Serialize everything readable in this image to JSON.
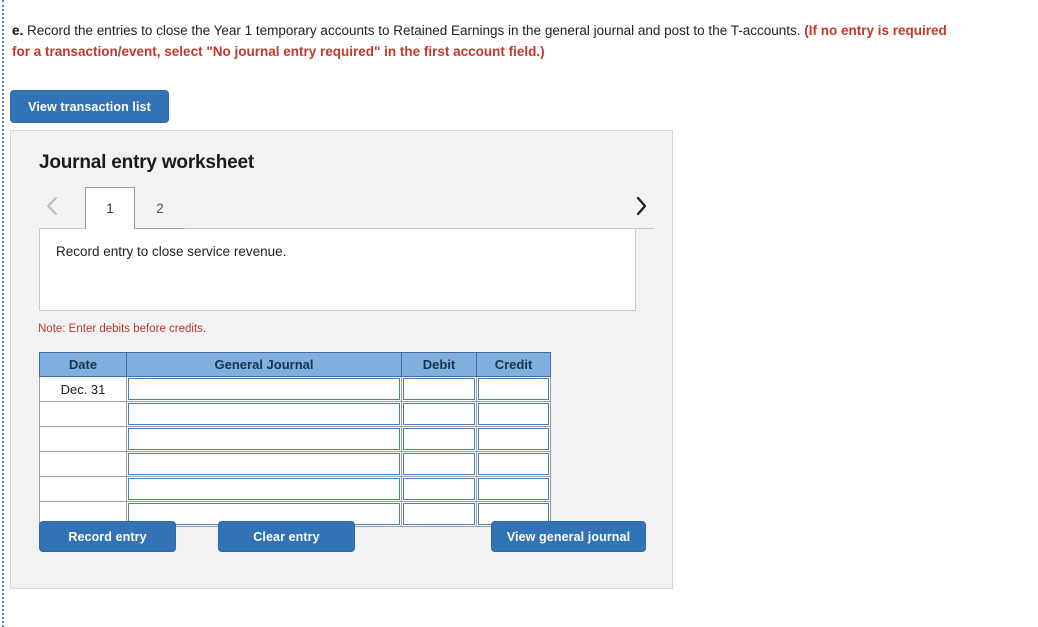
{
  "prompt": {
    "label": "e.",
    "text": " Record the entries to close the Year 1 temporary accounts to Retained Earnings in the general journal and post to the T-accounts. ",
    "requirement": "(If no entry is required for a transaction/event, select \"No journal entry required\" in the first account field.)"
  },
  "toolbar": {
    "view_transaction_list_label": "View transaction list"
  },
  "worksheet": {
    "title": "Journal entry worksheet",
    "prev_icon": "chevron-left-icon",
    "next_icon": "chevron-right-icon",
    "tabs": [
      {
        "label": "1",
        "active": true
      },
      {
        "label": "2",
        "active": false
      }
    ],
    "description": "Record entry to close service revenue.",
    "note": "Note: Enter debits before credits."
  },
  "journal_table": {
    "columns": [
      "Date",
      "General Journal",
      "Debit",
      "Credit"
    ],
    "rows": [
      {
        "date": "Dec. 31",
        "general_journal": "",
        "debit": "",
        "credit": ""
      },
      {
        "date": "",
        "general_journal": "",
        "debit": "",
        "credit": ""
      },
      {
        "date": "",
        "general_journal": "",
        "debit": "",
        "credit": ""
      },
      {
        "date": "",
        "general_journal": "",
        "debit": "",
        "credit": ""
      },
      {
        "date": "",
        "general_journal": "",
        "debit": "",
        "credit": ""
      },
      {
        "date": "",
        "general_journal": "",
        "debit": "",
        "credit": ""
      }
    ]
  },
  "actions": {
    "record_entry_label": "Record entry",
    "clear_entry_label": "Clear entry",
    "view_general_journal_label": "View general journal"
  },
  "colors": {
    "button_blue": "#3273b5",
    "table_header_blue": "#7fb0dd",
    "note_red": "#b33a3a",
    "requirement_red": "#c0392b",
    "panel_gray": "#f2f2f2",
    "input_border_blue": "#4a7fb5"
  }
}
